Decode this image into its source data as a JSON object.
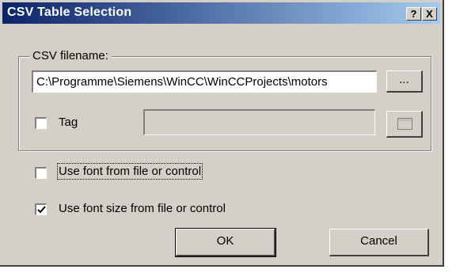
{
  "window": {
    "title": "CSV Table Selection"
  },
  "titlebar": {
    "help_label": "?",
    "close_label": "X"
  },
  "csv_group": {
    "label": "CSV filename:",
    "filename_value": "C:\\Programme\\Siemens\\WinCC\\WinCCProjects\\motors",
    "browse_label": "...",
    "tag_label": "Tag",
    "tag_checked": false,
    "tag_value": ""
  },
  "options": {
    "use_font_label": "Use font from file or control",
    "use_font_checked": false,
    "use_font_size_label": "Use font size from file or control",
    "use_font_size_checked": true
  },
  "buttons": {
    "ok_label": "OK",
    "cancel_label": "Cancel"
  }
}
